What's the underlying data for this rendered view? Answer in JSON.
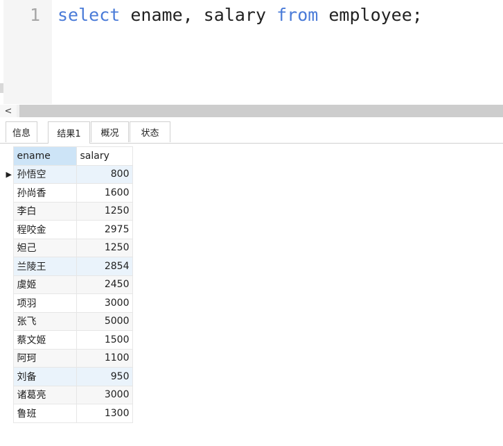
{
  "editor": {
    "line_number": "1",
    "code_tokens": [
      {
        "text": "select",
        "type": "keyword"
      },
      {
        "text": " ename, salary ",
        "type": "plain"
      },
      {
        "text": "from",
        "type": "keyword"
      },
      {
        "text": " employee;",
        "type": "plain"
      }
    ]
  },
  "scrollbar": {
    "left_arrow": "<"
  },
  "tabs": [
    {
      "label": "信息"
    },
    {
      "label": "结果1"
    },
    {
      "label": "概况"
    },
    {
      "label": "状态"
    }
  ],
  "result": {
    "columns": [
      "ename",
      "salary"
    ],
    "current_row_marker": "▶",
    "rows": [
      {
        "ename": "孙悟空",
        "salary": "800"
      },
      {
        "ename": "孙尚香",
        "salary": "1600"
      },
      {
        "ename": "李白",
        "salary": "1250"
      },
      {
        "ename": "程咬金",
        "salary": "2975"
      },
      {
        "ename": "妲己",
        "salary": "1250"
      },
      {
        "ename": "兰陵王",
        "salary": "2854"
      },
      {
        "ename": "虞姬",
        "salary": "2450"
      },
      {
        "ename": "项羽",
        "salary": "3000"
      },
      {
        "ename": "张飞",
        "salary": "5000"
      },
      {
        "ename": "蔡文姬",
        "salary": "1500"
      },
      {
        "ename": "阿珂",
        "salary": "1100"
      },
      {
        "ename": "刘备",
        "salary": "950"
      },
      {
        "ename": "诸葛亮",
        "salary": "3000"
      },
      {
        "ename": "鲁班",
        "salary": "1300"
      }
    ]
  },
  "colors": {
    "keyword": "#4a7bd8",
    "header_selected": "#cde4f7",
    "row_alt": "#f7f7f7"
  }
}
